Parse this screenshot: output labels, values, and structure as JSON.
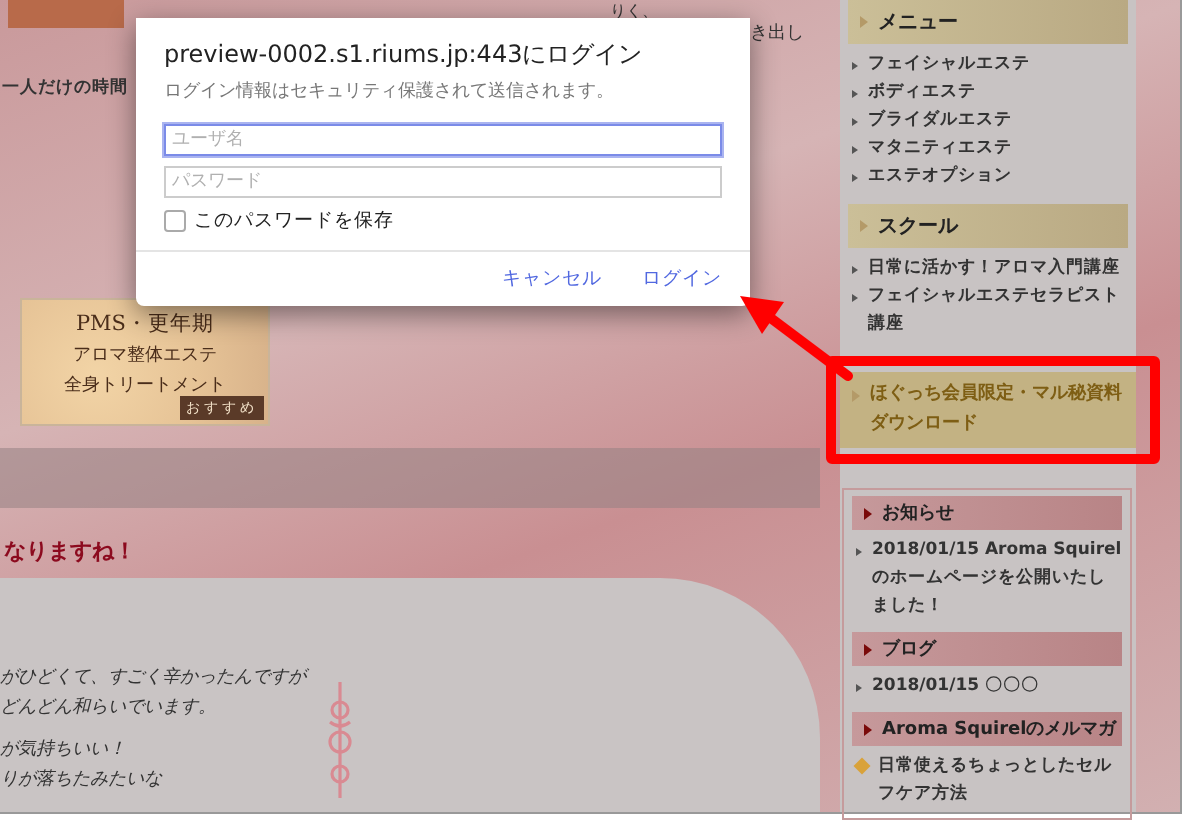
{
  "page": {
    "top_texts": [
      "りく、",
      "き出し"
    ],
    "intro_text": "一人だけの時間",
    "banner": {
      "lines": [
        "PMS・更年期",
        "アロマ整体エステ",
        "全身トリートメント"
      ],
      "badge": "おすすめ"
    },
    "heading": "なりますね！",
    "handwritten_lines": [
      "がひどくて、すごく辛かったんですが",
      "どんどん和らいでいます。",
      "が気持ちいい！",
      "りが落ちたみたいな"
    ]
  },
  "sidebar": [
    {
      "kind": "tan",
      "title": "メニュー",
      "items": [
        {
          "text": "フェイシャルエステ",
          "kind": "arrow"
        },
        {
          "text": "ボディエステ",
          "kind": "arrow"
        },
        {
          "text": "ブライダルエステ",
          "kind": "arrow"
        },
        {
          "text": "マタニティエステ",
          "kind": "arrow"
        },
        {
          "text": "エステオプション",
          "kind": "arrow"
        }
      ]
    },
    {
      "kind": "tan",
      "title": "スクール",
      "items": [
        {
          "text": "日常に活かす！アロマ入門講座",
          "kind": "arrow"
        },
        {
          "text": "フェイシャルエステセラピスト講座",
          "kind": "arrow"
        }
      ]
    },
    {
      "kind": "download",
      "title": "ほぐっち会員限定・マル秘資料ダウンロード",
      "highlighted": true
    },
    {
      "kind": "pink",
      "title": "お知らせ",
      "items": [
        {
          "text": "2018/01/15 Aroma Squirelのホームページを公開いたしました！",
          "kind": "arrow"
        }
      ]
    },
    {
      "kind": "pink",
      "title": "ブログ",
      "items": [
        {
          "text": "2018/01/15 〇〇〇",
          "kind": "arrow"
        }
      ]
    },
    {
      "kind": "pink",
      "title": "Aroma Squirelのメルマガ",
      "items": [
        {
          "text": "日常使えるちょっとしたセルフケア方法",
          "kind": "diamond"
        }
      ]
    }
  ],
  "dialog": {
    "title": "preview-0002.s1.riums.jp:443にログイン",
    "subtitle": "ログイン情報はセキュリティ保護されて送信されます。",
    "fields": [
      {
        "placeholder": "ユーザ名",
        "focused": true
      },
      {
        "placeholder": "パスワード",
        "focused": false
      }
    ],
    "remember": {
      "label": "このパスワードを保存",
      "checked": false
    },
    "buttons": [
      "キャンセル",
      "ログイン"
    ]
  }
}
